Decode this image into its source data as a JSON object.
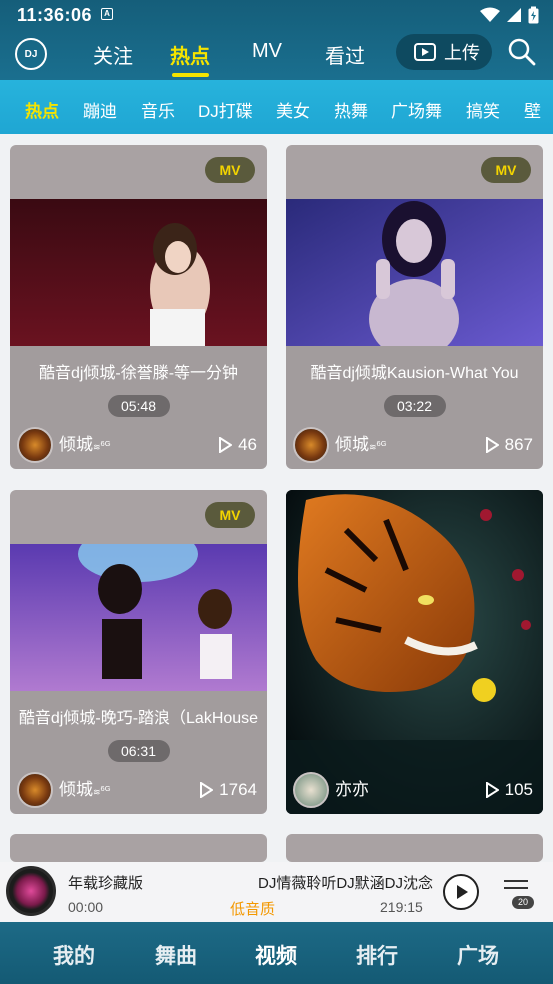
{
  "status": {
    "time": "11:36:06",
    "notif": "A"
  },
  "topnav": {
    "logo": "DJ",
    "tabs": [
      "关注",
      "热点",
      "MV",
      "看过"
    ],
    "active": "热点",
    "upload": "上传"
  },
  "categories": [
    "热点",
    "蹦迪",
    "音乐",
    "DJ打碟",
    "美女",
    "热舞",
    "广场舞",
    "搞笑",
    "壁"
  ],
  "cards": [
    {
      "badge": "MV",
      "title": "酷音dj倾城-徐誉滕-等一分钟",
      "duration": "05:48",
      "author": "倾城",
      "net": "6G",
      "plays": "46"
    },
    {
      "badge": "MV",
      "title": "酷音dj倾城Kausion-What You",
      "duration": "03:22",
      "author": "倾城",
      "net": "6G",
      "plays": "867"
    },
    {
      "badge": "MV",
      "title": "酷音dj倾城-晚巧-踏浪（LakHouse",
      "duration": "06:31",
      "author": "倾城",
      "net": "6G",
      "plays": "1764"
    },
    {
      "author": "亦亦",
      "plays": "105"
    }
  ],
  "player": {
    "song_left": "年载珍藏版",
    "song_right": "DJ情薇聆听DJ默涵DJ沈念",
    "time_start": "00:00",
    "quality": "低音质",
    "time_end": "219:15",
    "playlist_count": "20"
  },
  "bottomnav": [
    "我的",
    "舞曲",
    "视频",
    "排行",
    "广场"
  ],
  "bottom_active": "视频",
  "colors": {
    "accent": "#f5e400",
    "header": "#1a6f8f",
    "catbar": "#22aed8",
    "quality": "#f39800"
  }
}
